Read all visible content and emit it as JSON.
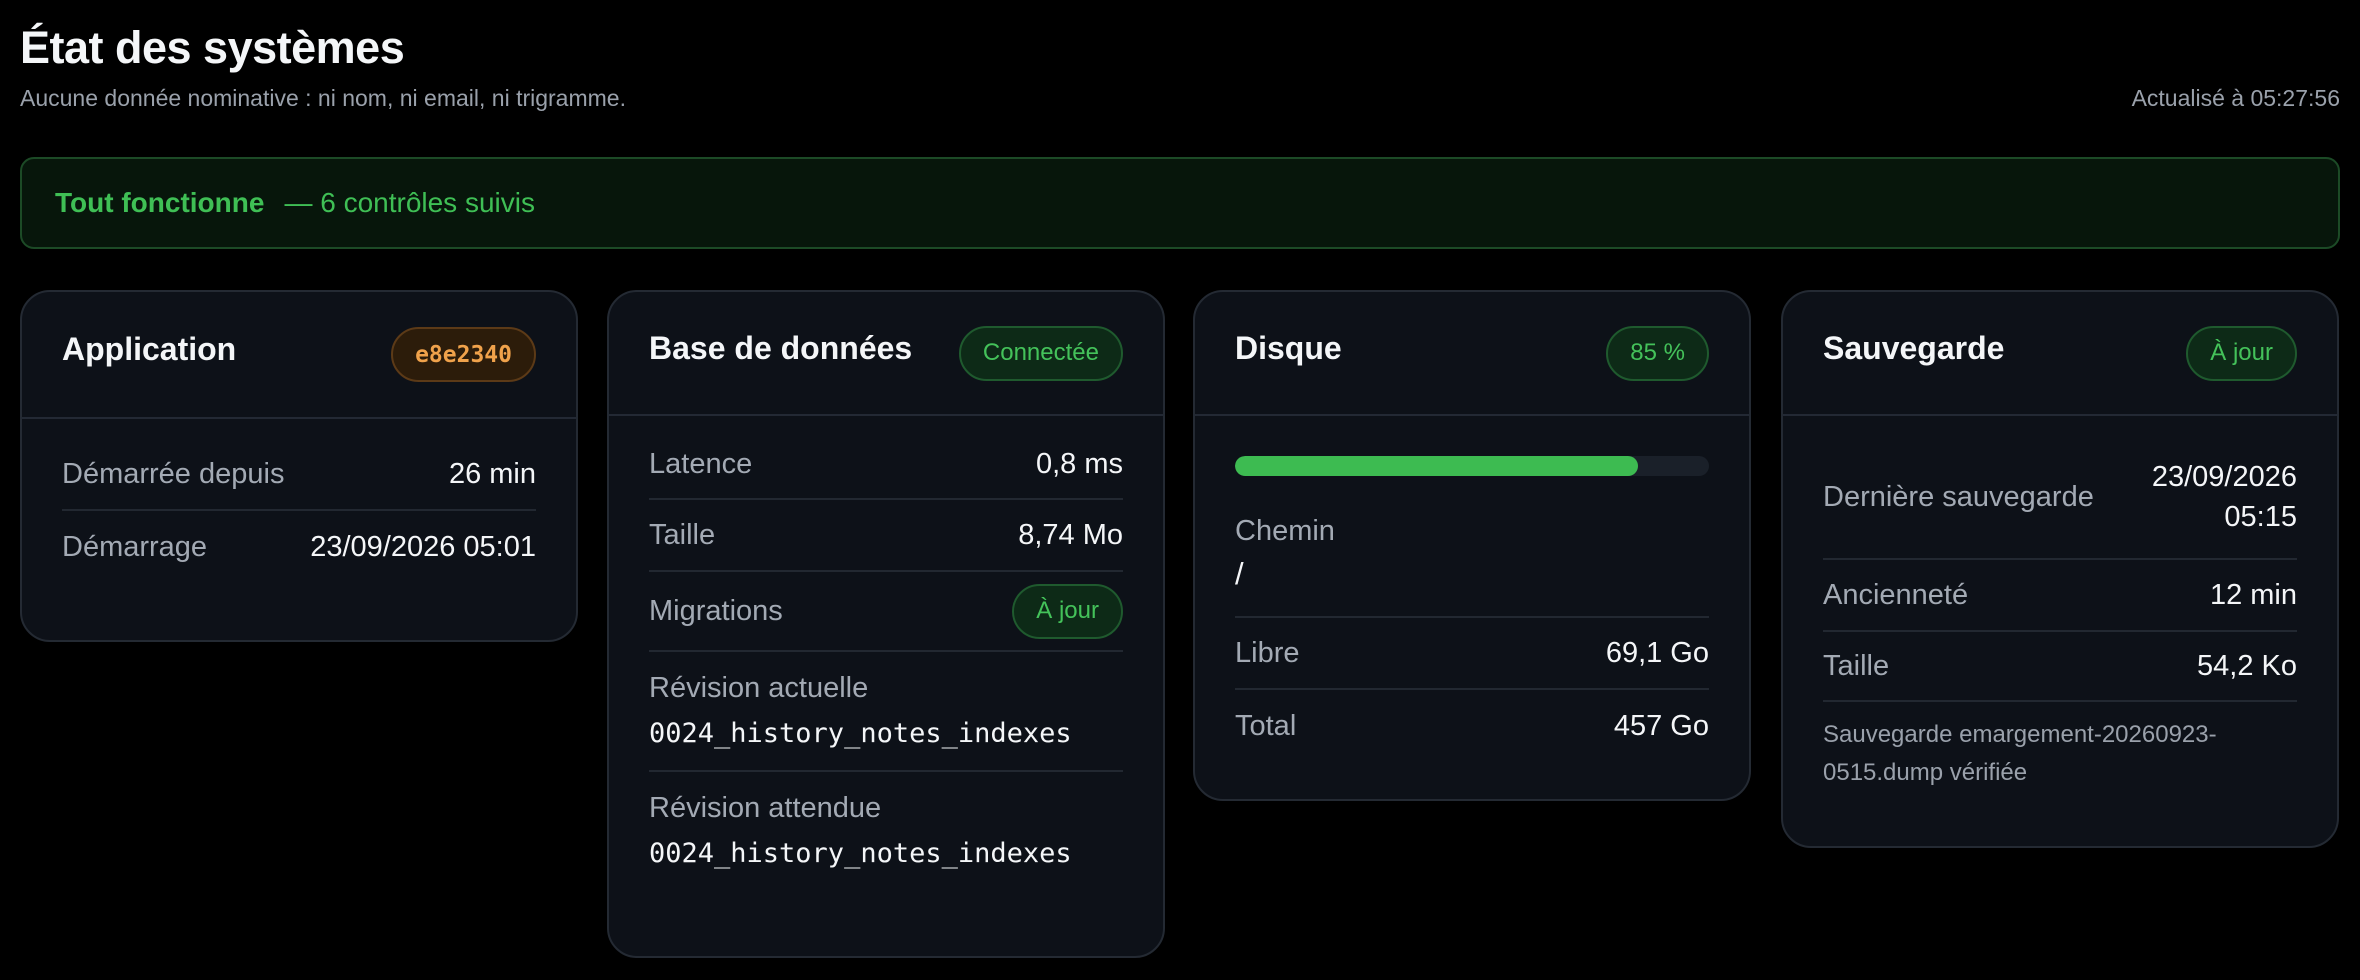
{
  "header": {
    "title": "État des systèmes",
    "subtitle": "Aucune donnée nominative : ni nom, ni email, ni trigramme.",
    "refreshed": "Actualisé à 05:27:56"
  },
  "banner": {
    "status": "Tout fonctionne",
    "detail": "— 6 contrôles suivis"
  },
  "application": {
    "title": "Application",
    "badge": "e8e2340",
    "rows": [
      {
        "label": "Démarrée depuis",
        "value": "26 min"
      },
      {
        "label": "Démarrage",
        "value": "23/09/2026 05:01"
      }
    ]
  },
  "database": {
    "title": "Base de données",
    "badge": "Connectée",
    "rows": [
      {
        "label": "Latence",
        "value": "0,8 ms"
      },
      {
        "label": "Taille",
        "value": "8,74 Mo"
      }
    ],
    "migrations_label": "Migrations",
    "migrations_badge": "À jour",
    "current_revision_label": "Révision actuelle",
    "current_revision": "0024_history_notes_indexes",
    "expected_revision_label": "Révision attendue",
    "expected_revision": "0024_history_notes_indexes"
  },
  "disk": {
    "title": "Disque",
    "badge": "85 %",
    "usage_fraction": 0.85,
    "path_label": "Chemin",
    "path": "/",
    "rows": [
      {
        "label": "Libre",
        "value": "69,1 Go"
      },
      {
        "label": "Total",
        "value": "457 Go"
      }
    ]
  },
  "backup": {
    "title": "Sauvegarde",
    "badge": "À jour",
    "last_label": "Dernière sauvegarde",
    "last_date": "23/09/2026",
    "last_time": "05:15",
    "rows": [
      {
        "label": "Ancienneté",
        "value": "12 min"
      },
      {
        "label": "Taille",
        "value": "54,2 Ko"
      }
    ],
    "note": "Sauvegarde emargement-20260923-0515.dump vérifiée"
  },
  "colors": {
    "background": "#000000",
    "card": "#0d1118",
    "ok_green": "#3fbf55",
    "hash_orange": "#f0a24b"
  }
}
